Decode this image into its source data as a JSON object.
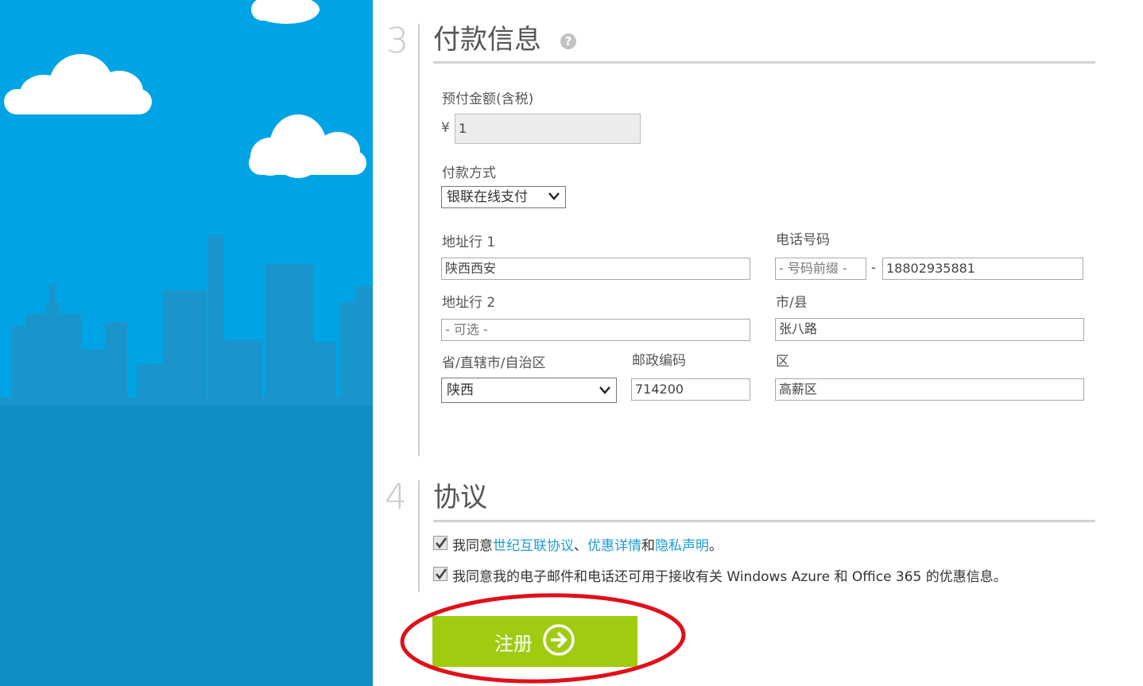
{
  "section3": {
    "number": "3",
    "title": "付款信息",
    "help_icon": "question-icon",
    "prepay_label": "预付金额(含税)",
    "currency_symbol": "¥",
    "prepay_value": "1",
    "payment_method_label": "付款方式",
    "payment_method_value": "银联在线支付",
    "address1_label": "地址行 1",
    "address1_value": "陕西西安",
    "phone_label": "电话号码",
    "phone_prefix_placeholder": "- 号码前缀 -",
    "phone_separator": "-",
    "phone_value": "18802935881",
    "address2_label": "地址行 2",
    "address2_placeholder": "- 可选 -",
    "city_label": "市/县",
    "city_value": "张八路",
    "province_label": "省/直辖市/自治区",
    "province_value": "陕西",
    "postal_label": "邮政编码",
    "postal_value": "714200",
    "district_label": "区",
    "district_value": "高薪区"
  },
  "section4": {
    "number": "4",
    "title": "协议",
    "agree1_prefix": "我同意",
    "agree1_link1": "世纪互联协议",
    "agree1_sep": "、",
    "agree1_link2": "优惠详情",
    "agree1_and": "和",
    "agree1_link3": "隐私声明",
    "agree1_end": "。",
    "agree1_checked": true,
    "agree2_text": "我同意我的电子邮件和电话还可用于接收有关 Windows Azure 和 Office 365 的优惠信息。",
    "agree2_checked": true
  },
  "register_button": {
    "label": "注册",
    "icon": "arrow-right-circle-icon"
  },
  "colors": {
    "sky": "#00a4e4",
    "skyline": "#1f97cc",
    "button": "#9fcc10",
    "link": "#1e9bd7",
    "annotation": "#e0101a"
  }
}
